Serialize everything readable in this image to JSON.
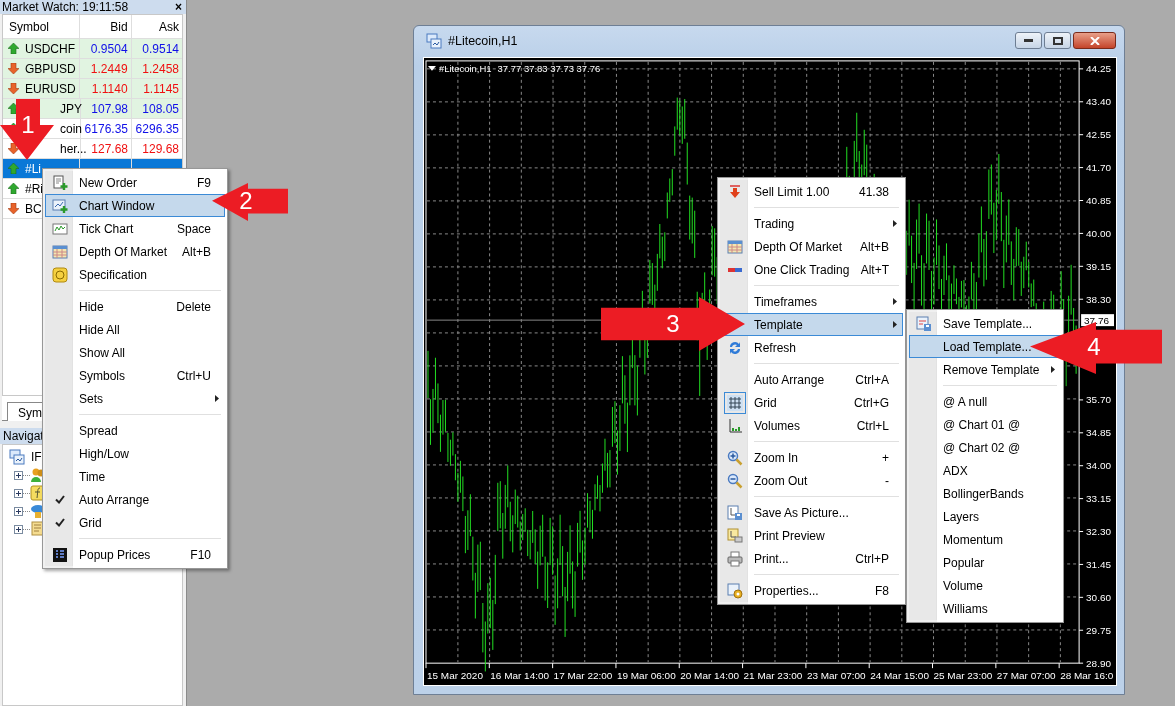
{
  "market_watch": {
    "title": "Market Watch: 19:11:58",
    "close": "×",
    "columns": [
      "Symbol",
      "Bid",
      "Ask"
    ],
    "rows": [
      {
        "symbol": "USDCHF",
        "bid": "0.9504",
        "ask": "0.9514",
        "kind": "up",
        "highlighted": true,
        "selected": false,
        "cut": false
      },
      {
        "symbol": "GBPUSD",
        "bid": "1.2449",
        "ask": "1.2458",
        "kind": "down",
        "highlighted": true,
        "selected": false,
        "cut": false
      },
      {
        "symbol": "EURUSD",
        "bid": "1.1140",
        "ask": "1.1145",
        "kind": "down",
        "highlighted": true,
        "selected": false,
        "cut": false
      },
      {
        "symbol": "JPY",
        "bid": "107.98",
        "ask": "108.05",
        "kind": "up",
        "highlighted": true,
        "selected": false,
        "cut": true
      },
      {
        "symbol": "coin",
        "bid": "6176.35",
        "ask": "6296.35",
        "kind": "up",
        "highlighted": false,
        "selected": false,
        "cut": true
      },
      {
        "symbol": "her...",
        "bid": "127.68",
        "ask": "129.68",
        "kind": "down",
        "highlighted": false,
        "selected": false,
        "cut": true
      },
      {
        "symbol": "#Li",
        "kind": "up",
        "highlighted": false,
        "selected": true,
        "cut": false
      },
      {
        "symbol": "#Ri",
        "kind": "up",
        "highlighted": false,
        "selected": false,
        "cut": false
      },
      {
        "symbol": "BC",
        "kind": "down",
        "highlighted": false,
        "selected": false,
        "cut": false
      }
    ]
  },
  "symbols_tab": {
    "label": "Sym",
    "selected": true
  },
  "navigator": {
    "title": "Navigat",
    "root": "IF",
    "children": [
      {
        "expanded": false
      },
      {
        "expanded": false
      },
      {
        "expanded": false
      },
      {
        "expanded": false
      }
    ]
  },
  "chart_window": {
    "title": "#Litecoin,H1",
    "header_symbol": "#Litecoin,H1",
    "header_prices": "37.77 37.83 37.73 37.76",
    "price_labels": [
      "44.25",
      "43.40",
      "42.55",
      "41.70",
      "40.85",
      "40.00",
      "39.15",
      "38.30",
      "35.70",
      "34.85",
      "34.00",
      "33.15",
      "32.30",
      "31.45",
      "30.60",
      "29.75",
      "28.90"
    ],
    "current_price": "37.76",
    "time_labels": [
      "15 Mar 2020",
      "16 Mar 14:00",
      "17 Mar 22:00",
      "19 Mar 06:00",
      "20 Mar 14:00",
      "21 Mar 23:00",
      "23 Mar 07:00",
      "24 Mar 15:00",
      "25 Mar 23:00",
      "27 Mar 07:00",
      "28 Mar 16:0"
    ]
  },
  "symbol_menu": {
    "items": [
      {
        "kind": "item",
        "label": "New Order",
        "shortcut": "F9",
        "submenu": false,
        "checked": false,
        "selected": false
      },
      {
        "kind": "item",
        "label": "Chart Window",
        "submenu": false,
        "checked": false,
        "selected": true
      },
      {
        "kind": "item",
        "label": "Tick Chart",
        "shortcut": "Space",
        "submenu": false,
        "checked": false,
        "selected": false
      },
      {
        "kind": "item",
        "label": "Depth Of Market",
        "shortcut": "Alt+B",
        "submenu": false,
        "checked": false,
        "selected": false
      },
      {
        "kind": "item",
        "label": "Specification",
        "submenu": false,
        "checked": false,
        "selected": false
      },
      {
        "kind": "separator"
      },
      {
        "kind": "item",
        "label": "Hide",
        "shortcut": "Delete",
        "submenu": false,
        "checked": false,
        "selected": false
      },
      {
        "kind": "item",
        "label": "Hide All",
        "submenu": false,
        "checked": false,
        "selected": false
      },
      {
        "kind": "item",
        "label": "Show All",
        "submenu": false,
        "checked": false,
        "selected": false
      },
      {
        "kind": "item",
        "label": "Symbols",
        "shortcut": "Ctrl+U",
        "submenu": false,
        "checked": false,
        "selected": false
      },
      {
        "kind": "item",
        "label": "Sets",
        "submenu": true,
        "checked": false,
        "selected": false
      },
      {
        "kind": "separator"
      },
      {
        "kind": "item",
        "label": "Spread",
        "submenu": false,
        "checked": false,
        "selected": false
      },
      {
        "kind": "item",
        "label": "High/Low",
        "submenu": false,
        "checked": false,
        "selected": false
      },
      {
        "kind": "item",
        "label": "Time",
        "submenu": false,
        "checked": false,
        "selected": false
      },
      {
        "kind": "item",
        "label": "Auto Arrange",
        "submenu": false,
        "checked": true,
        "selected": false
      },
      {
        "kind": "item",
        "label": "Grid",
        "submenu": false,
        "checked": true,
        "selected": false
      },
      {
        "kind": "separator"
      },
      {
        "kind": "item",
        "label": "Popup Prices",
        "shortcut": "F10",
        "submenu": false,
        "checked": false,
        "selected": false
      }
    ]
  },
  "chart_menu": {
    "items": [
      {
        "kind": "item",
        "label": "Sell Limit 1.00",
        "shortcut": "41.38",
        "submenu": false,
        "checked": false,
        "selected": false
      },
      {
        "kind": "separator"
      },
      {
        "kind": "item",
        "label": "Trading",
        "submenu": true,
        "checked": false,
        "selected": false
      },
      {
        "kind": "item",
        "label": "Depth Of Market",
        "shortcut": "Alt+B",
        "submenu": false,
        "checked": false,
        "selected": false
      },
      {
        "kind": "item",
        "label": "One Click Trading",
        "shortcut": "Alt+T",
        "submenu": false,
        "checked": false,
        "selected": false
      },
      {
        "kind": "separator"
      },
      {
        "kind": "item",
        "label": "Timeframes",
        "submenu": true,
        "checked": false,
        "selected": false
      },
      {
        "kind": "item",
        "label": "Template",
        "submenu": true,
        "selected": true
      },
      {
        "kind": "item",
        "label": "Refresh",
        "submenu": false,
        "checked": false,
        "selected": false
      },
      {
        "kind": "separator"
      },
      {
        "kind": "item",
        "label": "Auto Arrange",
        "shortcut": "Ctrl+A",
        "submenu": false,
        "checked": false,
        "selected": false
      },
      {
        "kind": "item",
        "label": "Grid",
        "shortcut": "Ctrl+G",
        "submenu": false,
        "checked": true,
        "selected": false
      },
      {
        "kind": "item",
        "label": "Volumes",
        "shortcut": "Ctrl+L",
        "submenu": false,
        "checked": false,
        "selected": false
      },
      {
        "kind": "separator"
      },
      {
        "kind": "item",
        "label": "Zoom In",
        "shortcut": "+",
        "submenu": false,
        "checked": false,
        "selected": false
      },
      {
        "kind": "item",
        "label": "Zoom Out",
        "shortcut": "-",
        "submenu": false,
        "checked": false,
        "selected": false
      },
      {
        "kind": "separator"
      },
      {
        "kind": "item",
        "label": "Save As Picture...",
        "submenu": false,
        "checked": false,
        "selected": false
      },
      {
        "kind": "item",
        "label": "Print Preview",
        "submenu": false,
        "checked": false,
        "selected": false
      },
      {
        "kind": "item",
        "label": "Print...",
        "shortcut": "Ctrl+P",
        "submenu": false,
        "checked": false,
        "selected": false
      },
      {
        "kind": "separator"
      },
      {
        "kind": "item",
        "label": "Properties...",
        "shortcut": "F8",
        "submenu": false,
        "checked": false,
        "selected": false
      }
    ]
  },
  "template_menu": {
    "items": [
      {
        "kind": "item",
        "label": "Save Template...",
        "submenu": false,
        "checked": false,
        "selected": false
      },
      {
        "kind": "item",
        "label": "Load Template...",
        "submenu": false,
        "checked": false,
        "selected": true
      },
      {
        "kind": "item",
        "label": "Remove Template",
        "submenu": true,
        "checked": false,
        "selected": false
      },
      {
        "kind": "separator"
      },
      {
        "kind": "item",
        "label": "@ A null",
        "submenu": false,
        "checked": false,
        "selected": false
      },
      {
        "kind": "item",
        "label": "@ Chart 01 @",
        "submenu": false,
        "checked": false,
        "selected": false
      },
      {
        "kind": "item",
        "label": "@ Chart 02 @",
        "submenu": false,
        "checked": false,
        "selected": false
      },
      {
        "kind": "item",
        "label": "ADX",
        "submenu": false,
        "checked": false,
        "selected": false
      },
      {
        "kind": "item",
        "label": "BollingerBands",
        "submenu": false,
        "checked": false,
        "selected": false
      },
      {
        "kind": "item",
        "label": "Layers",
        "submenu": false,
        "checked": false,
        "selected": false
      },
      {
        "kind": "item",
        "label": "Momentum",
        "submenu": false,
        "checked": false,
        "selected": false
      },
      {
        "kind": "item",
        "label": "Popular",
        "submenu": false,
        "checked": false,
        "selected": false
      },
      {
        "kind": "item",
        "label": "Volume",
        "submenu": false,
        "checked": false,
        "selected": false
      },
      {
        "kind": "item",
        "label": "Williams",
        "submenu": false,
        "checked": false,
        "selected": false
      }
    ]
  },
  "callouts": [
    {
      "label": "1",
      "kind": "down"
    },
    {
      "label": "2",
      "kind": "left"
    },
    {
      "label": "3",
      "kind": "right"
    },
    {
      "label": "4",
      "kind": "left"
    }
  ]
}
